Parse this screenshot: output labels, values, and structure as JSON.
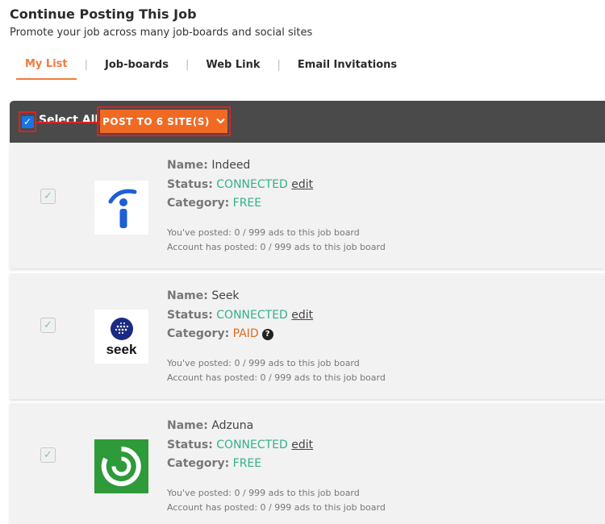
{
  "header": {
    "title": "Continue Posting This Job",
    "subtitle": "Promote your job across many job-boards and social sites"
  },
  "tabs": [
    {
      "label": "My List",
      "active": true
    },
    {
      "label": "Job-boards",
      "active": false
    },
    {
      "label": "Web Link",
      "active": false
    },
    {
      "label": "Email Invitations",
      "active": false
    }
  ],
  "toolbar": {
    "select_all_label": "Select All",
    "select_all_checked": true,
    "post_button_label": "POST TO 6 SITE(S)"
  },
  "labels": {
    "name": "Name:",
    "status": "Status:",
    "category": "Category:",
    "edit": "edit"
  },
  "boards": [
    {
      "name": "Indeed",
      "status": "CONNECTED",
      "category": "FREE",
      "checked": true,
      "logo_icon": "indeed-logo-icon",
      "you_posted": "You've posted: 0 / 999 ads to this job board",
      "account_posted": "Account has posted: 0 / 999 ads to this job board"
    },
    {
      "name": "Seek",
      "status": "CONNECTED",
      "category": "PAID",
      "checked": true,
      "logo_icon": "seek-logo-icon",
      "logo_text": "seek",
      "you_posted": "You've posted: 0 / 999 ads to this job board",
      "account_posted": "Account has posted: 0 / 999 ads to this job board"
    },
    {
      "name": "Adzuna",
      "status": "CONNECTED",
      "category": "FREE",
      "checked": true,
      "logo_icon": "adzuna-logo-icon",
      "you_posted": "You've posted: 0 / 999 ads to this job board",
      "account_posted": "Account has posted: 0 / 999 ads to this job board"
    }
  ],
  "colors": {
    "accent": "#f06a24",
    "connected": "#33b08c",
    "paid": "#e06a1e",
    "toolbar_bg": "#4a4a4a",
    "highlight": "#e02020"
  }
}
